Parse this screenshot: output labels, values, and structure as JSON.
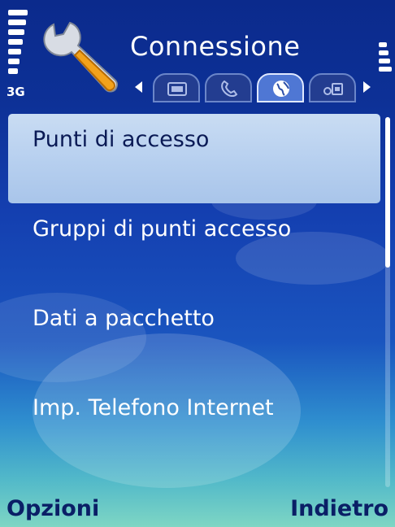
{
  "header": {
    "network_type": "3G",
    "title": "Connessione",
    "signal_strength": 1.0,
    "battery_level": 1.0,
    "tabs": [
      {
        "icon": "screen-icon",
        "active": false
      },
      {
        "icon": "phone-icon",
        "active": false
      },
      {
        "icon": "globe-icon",
        "active": true
      },
      {
        "icon": "settings-icon",
        "active": false
      }
    ]
  },
  "menu": {
    "items": [
      {
        "label": "Punti di accesso",
        "selected": true
      },
      {
        "label": "Gruppi di punti accesso",
        "selected": false
      },
      {
        "label": "Dati a pacchetto",
        "selected": false
      },
      {
        "label": "Imp. Telefono Internet",
        "selected": false
      }
    ]
  },
  "softkeys": {
    "left": "Opzioni",
    "right": "Indietro"
  },
  "colors": {
    "highlight": "#b6cfef",
    "softkey_text": "#0a1f66",
    "background_top": "#0b2a8c",
    "background_bottom": "#7ed6c4"
  }
}
